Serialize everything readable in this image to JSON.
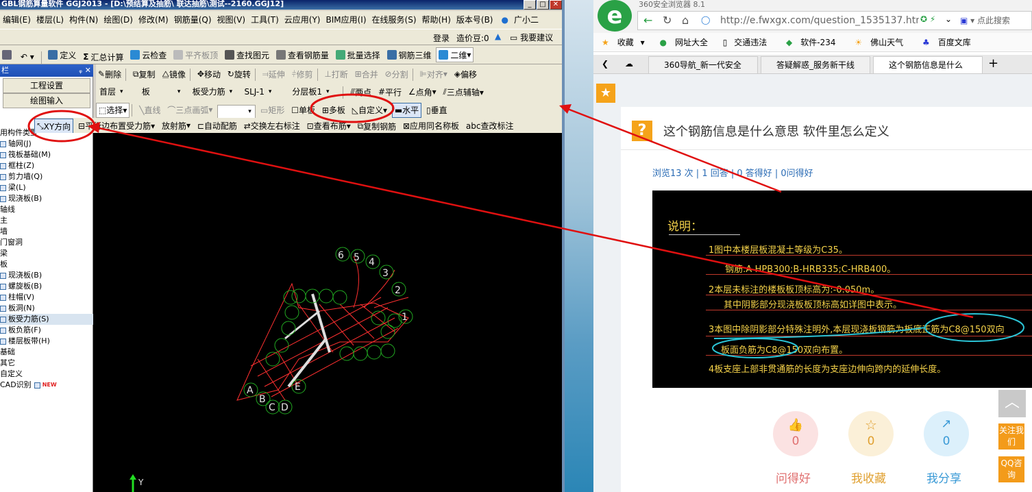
{
  "app": {
    "title": "GBL钢筋算量软件 GGJ2013 - [D:\\预结算及抽筋\\ 联达抽筋\\测试--2160.GGJ12]",
    "menu": [
      "编辑(E)",
      "楼层(L)",
      "构件(N)",
      "绘图(D)",
      "修改(M)",
      "钢筋量(Q)",
      "视图(V)",
      "工具(T)",
      "云应用(Y)",
      "BIM应用(I)",
      "在线服务(S)",
      "帮助(H)",
      "版本号(B)",
      "广小二"
    ],
    "login": {
      "login": "登录",
      "price": "造价豆:0",
      "suggest": "我要建议"
    },
    "toolbar1": [
      "定义",
      "汇总计算",
      "云检查",
      "平齐板顶",
      "查找图元",
      "查看钢筋量",
      "批量选择",
      "钢筋三维",
      "二维"
    ],
    "panel": {
      "head": "栏",
      "btn1": "工程设置",
      "btn2": "绘图输入"
    },
    "tree": [
      "用构件类型",
      "轴网(J)",
      "筏板基础(M)",
      "框柱(Z)",
      "剪力墙(Q)",
      "梁(L)",
      "现浇板(B)",
      "轴线",
      "主",
      "墙",
      "门窗洞",
      "梁",
      "板",
      "现浇板(B)",
      "螺旋板(B)",
      "柱帽(V)",
      "板洞(N)",
      "板受力筋(S)",
      "板负筋(F)",
      "楼层板带(H)",
      "基础",
      "其它",
      "自定义",
      "CAD识别"
    ],
    "tree_new": "NEW",
    "toolbar2": [
      "删除",
      "复制",
      "镜像",
      "移动",
      "旋转",
      "延伸",
      "修剪",
      "打断",
      "合并",
      "分割",
      "对齐",
      "偏移"
    ],
    "toolbar3": {
      "floor": "首层",
      "type": "板",
      "sub": "板受力筋",
      "name": "SLJ-1",
      "layer": "分层板1",
      "tools": [
        "两点",
        "平行",
        "点角",
        "三点辅轴"
      ]
    },
    "toolbar4": [
      "选择",
      "直线",
      "三点画弧",
      "矩形",
      "单板",
      "多板",
      "自定义",
      "水平",
      "垂直"
    ],
    "toolbar5": [
      "XY方向",
      "平行边布置受力筋",
      "放射筋",
      "自动配筋",
      "交换左右标注",
      "查看布筋",
      "复制钢筋",
      "应用同名称板",
      "查改标注"
    ],
    "canvas": {
      "axis": "Y",
      "labels": [
        "6",
        "5",
        "4",
        "3",
        "2",
        "1",
        "A",
        "B",
        "C",
        "D",
        "E"
      ]
    }
  },
  "browser": {
    "title": "360安全浏览器 8.1",
    "url": "http://e.fwxgx.com/question_1535137.htm",
    "search": "点此搜索",
    "bookmarks": [
      "收藏",
      "网址大全",
      "交通违法",
      "软件-234",
      "佛山天气",
      "百度文库"
    ],
    "tabs": [
      "360导航_新一代安全",
      "答疑解惑_服务新干线",
      "这个钢筋信息是什么"
    ],
    "question": {
      "title": "这个钢筋信息是什么意思 软件里怎么定义",
      "stats": "浏览13 次 | 1 回答 | 0 答得好 | 0问得好",
      "img": {
        "heading": "说明：",
        "lines": [
          "1图中本楼层板混凝土等级为C35。",
          "钢筋:A-HPB300;B-HRB335;C-HRB400。",
          "2本层未标注的楼板板顶标高为:-0.050m。",
          "其中阴影部分现浇板板顶标高如详图中表示。",
          "3本图中除阴影部分特殊注明外,本层现浇板钢筋为板底正筋为C8@150双向",
          "板面负筋为C8@150双向布置。",
          "4板支座上部非贯通筋的长度为支座边伸向跨内的延伸长度。"
        ]
      },
      "actions": [
        {
          "label": "问得好",
          "count": "0"
        },
        {
          "label": "我收藏",
          "count": "0"
        },
        {
          "label": "我分享",
          "count": "0"
        }
      ],
      "side": [
        "关注我们",
        "QQ咨询"
      ]
    }
  }
}
